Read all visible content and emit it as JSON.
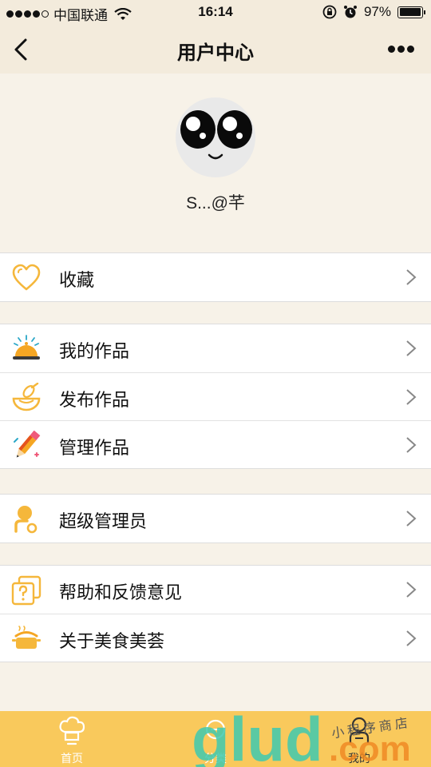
{
  "status_bar": {
    "carrier": "中国联通",
    "time": "16:14",
    "battery": "97%",
    "battery_level": 0.97,
    "signal_bars": 4,
    "icons": [
      "wifi-icon",
      "rotation-lock-icon",
      "alarm-icon"
    ]
  },
  "navbar": {
    "title": "用户中心",
    "back_icon": "chevron-left-icon",
    "more_icon": "more-dots-icon"
  },
  "profile": {
    "username": "S...@芊",
    "avatar": "cute-face-avatar"
  },
  "menu_groups": [
    [
      {
        "label": "收藏",
        "icon": "heart-icon"
      }
    ],
    [
      {
        "label": "我的作品",
        "icon": "serving-dish-icon"
      },
      {
        "label": "发布作品",
        "icon": "whisk-bowl-icon"
      },
      {
        "label": "管理作品",
        "icon": "pencil-icon"
      }
    ],
    [
      {
        "label": "超级管理员",
        "icon": "admin-user-icon"
      }
    ],
    [
      {
        "label": "帮助和反馈意见",
        "icon": "help-icon"
      },
      {
        "label": "关于美食美荟",
        "icon": "cooking-pot-icon"
      }
    ]
  ],
  "tabbar": [
    {
      "label": "首页",
      "icon": "chef-hat-icon"
    },
    {
      "label": "分类",
      "icon": "category-icon"
    },
    {
      "label": "我的",
      "icon": "user-icon"
    }
  ],
  "watermark": {
    "text": "glud.com",
    "subtext": "小 程 序 商 店"
  },
  "colors": {
    "background": "#f7f2e8",
    "header": "#f3ebdc",
    "tabbar": "#f9c95c",
    "icon_accent": "#f5b73b"
  }
}
